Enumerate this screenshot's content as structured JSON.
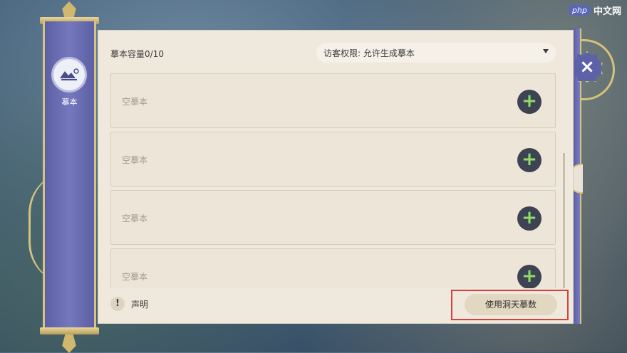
{
  "watermark": {
    "brand": "php",
    "site": "中文网"
  },
  "sidebar": {
    "label": "摹本",
    "icon": "blueprint-mountain-icon"
  },
  "header": {
    "capacity": "摹本容量0/10",
    "permission": "访客权限: 允许生成摹本"
  },
  "slots": [
    {
      "label": "空摹本"
    },
    {
      "label": "空摹本"
    },
    {
      "label": "空摹本"
    },
    {
      "label": "空摹本"
    }
  ],
  "footer": {
    "notice": "声明",
    "use_button": "使用洞天摹数"
  },
  "icons": {
    "close": "×",
    "add": "+",
    "notice": "!"
  },
  "colors": {
    "accent": "#5d61a8",
    "highlight": "#d8403f",
    "add_plus": "#8fdc67"
  }
}
